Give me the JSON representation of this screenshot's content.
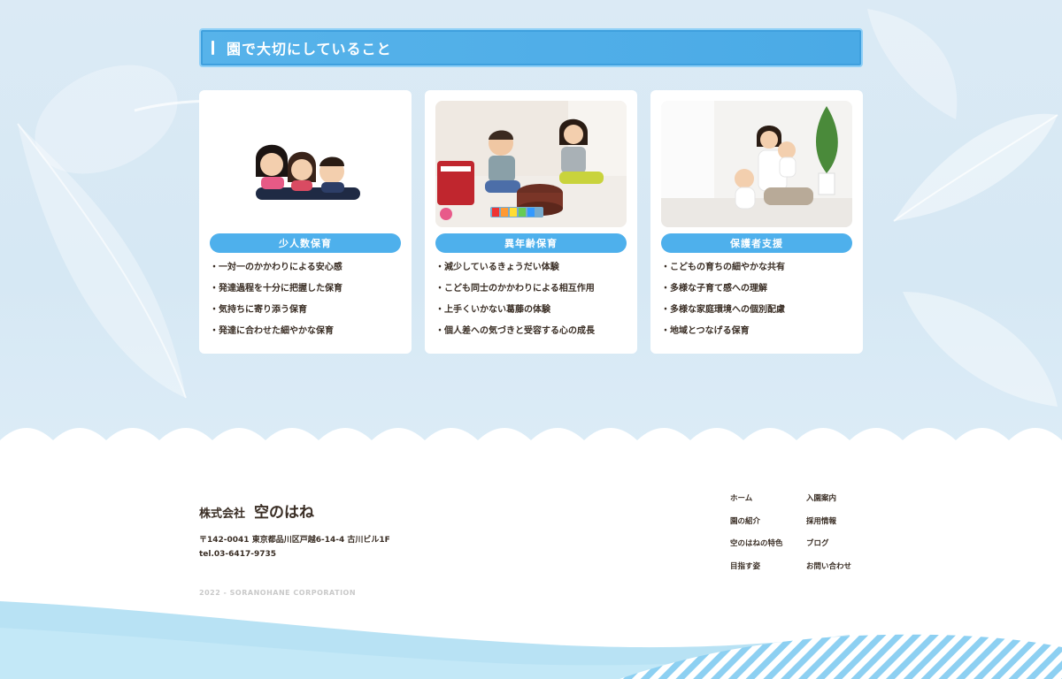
{
  "section": {
    "title": "園で大切にしていること"
  },
  "cards": [
    {
      "title": "少人数保育",
      "items": [
        "・一対一のかかわりによる安心感",
        "・発達過程を十分に把握した保育",
        "・気持ちに寄り添う保育",
        "・発達に合わせた細やかな保育"
      ]
    },
    {
      "title": "異年齢保育",
      "items": [
        "・減少しているきょうだい体験",
        "・こども同士のかかわりによる相互作用",
        "・上手くいかない葛藤の体験",
        "・個人差への気づきと受容する心の成長"
      ]
    },
    {
      "title": "保護者支援",
      "items": [
        "・こどもの育ちの細やかな共有",
        "・多様な子育て感への理解",
        "・多様な家庭環境への個別配慮",
        "・地域とつなげる保育"
      ]
    }
  ],
  "footer": {
    "company_kind": "株式会社",
    "company_name": "空のはね",
    "address": "〒142-0041 東京都品川区戸越6-14-4 古川ビル1F",
    "tel": "tel.03-6417-9735",
    "copyright": "2022 - SORANOHANE CORPORATION",
    "nav_left": [
      "ホーム",
      "園の紹介",
      "空のはねの特色",
      "目指す姿"
    ],
    "nav_right": [
      "入園案内",
      "採用情報",
      "ブログ",
      "お問い合わせ"
    ]
  },
  "colors": {
    "accent_blue": "#4eb0ec",
    "sky": "#d6e8f4",
    "text": "#3a2e25"
  }
}
